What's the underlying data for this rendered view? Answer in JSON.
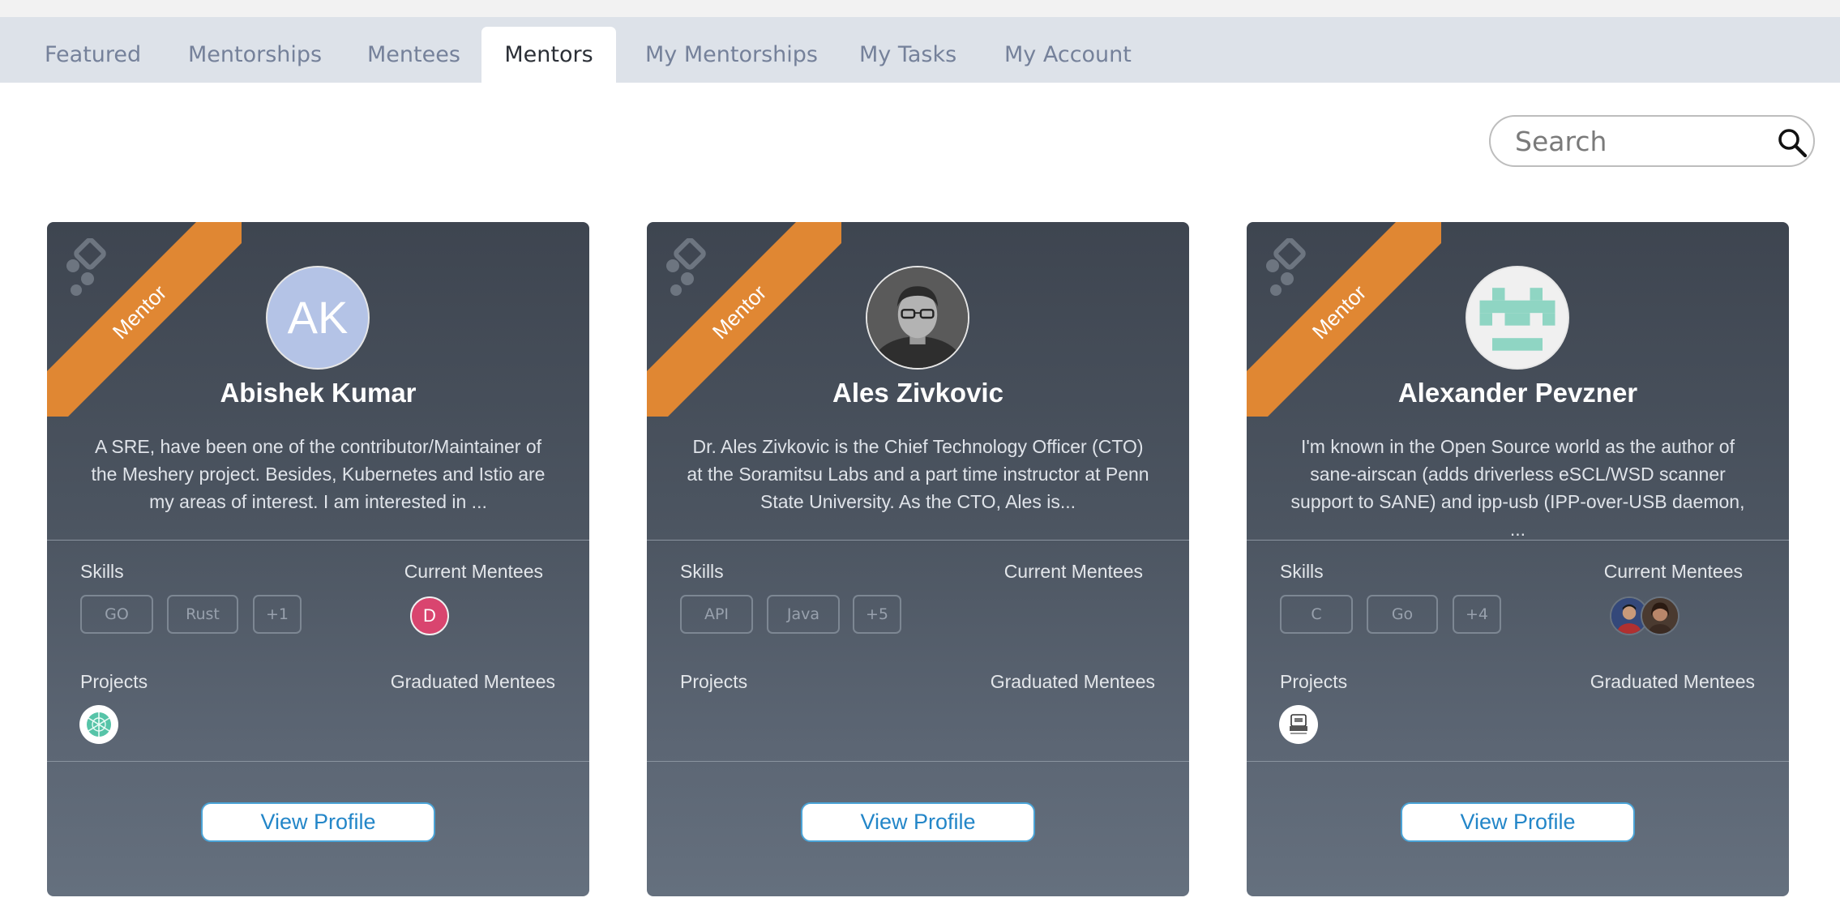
{
  "tabs": [
    {
      "label": "Featured"
    },
    {
      "label": "Mentorships"
    },
    {
      "label": "Mentees"
    },
    {
      "label": "Mentors",
      "active": true
    },
    {
      "label": "My Mentorships"
    },
    {
      "label": "My Tasks"
    },
    {
      "label": "My Account"
    }
  ],
  "search": {
    "placeholder": "Search",
    "value": "",
    "icon": "search-icon"
  },
  "labels": {
    "ribbon": "Mentor",
    "skills": "Skills",
    "current_mentees": "Current Mentees",
    "projects": "Projects",
    "graduated_mentees": "Graduated Mentees",
    "view_profile": "View Profile"
  },
  "colors": {
    "ribbon": "#e08733",
    "button_text": "#2386c8",
    "tab_bar": "#dde2e9"
  },
  "mentors": [
    {
      "name": "Abishek Kumar",
      "avatar_initials": "AK",
      "bio": "A SRE, have been one of the contributor/Maintainer of the Meshery project. Besides, Kubernetes and Istio are my areas of interest. I am interested in ...",
      "skills": [
        "GO",
        "Rust",
        "+1"
      ],
      "current_mentees": [
        {
          "initial": "D",
          "color": "#d9456f"
        }
      ],
      "projects": [
        "project-logo"
      ]
    },
    {
      "name": "Ales Zivkovic",
      "avatar_initials": "",
      "bio": "Dr. Ales Zivkovic is the Chief Technology Officer (CTO) at the Soramitsu Labs and a part time instructor at Penn State University. As the CTO, Ales is...",
      "skills": [
        "API",
        "Java",
        "+5"
      ],
      "current_mentees": [],
      "projects": []
    },
    {
      "name": "Alexander Pevzner",
      "avatar_initials": "",
      "bio": "I'm known in the Open Source world as the author of sane-airscan (adds driverless eSCL/WSD scanner support to SANE) and ipp-usb (IPP-over-USB daemon, ...",
      "skills": [
        "C",
        "Go",
        "+4"
      ],
      "current_mentees": [
        {
          "initial": "",
          "color": "#2c3e66"
        },
        {
          "initial": "",
          "color": "#5a4636"
        }
      ],
      "projects": [
        "project-logo"
      ]
    }
  ]
}
